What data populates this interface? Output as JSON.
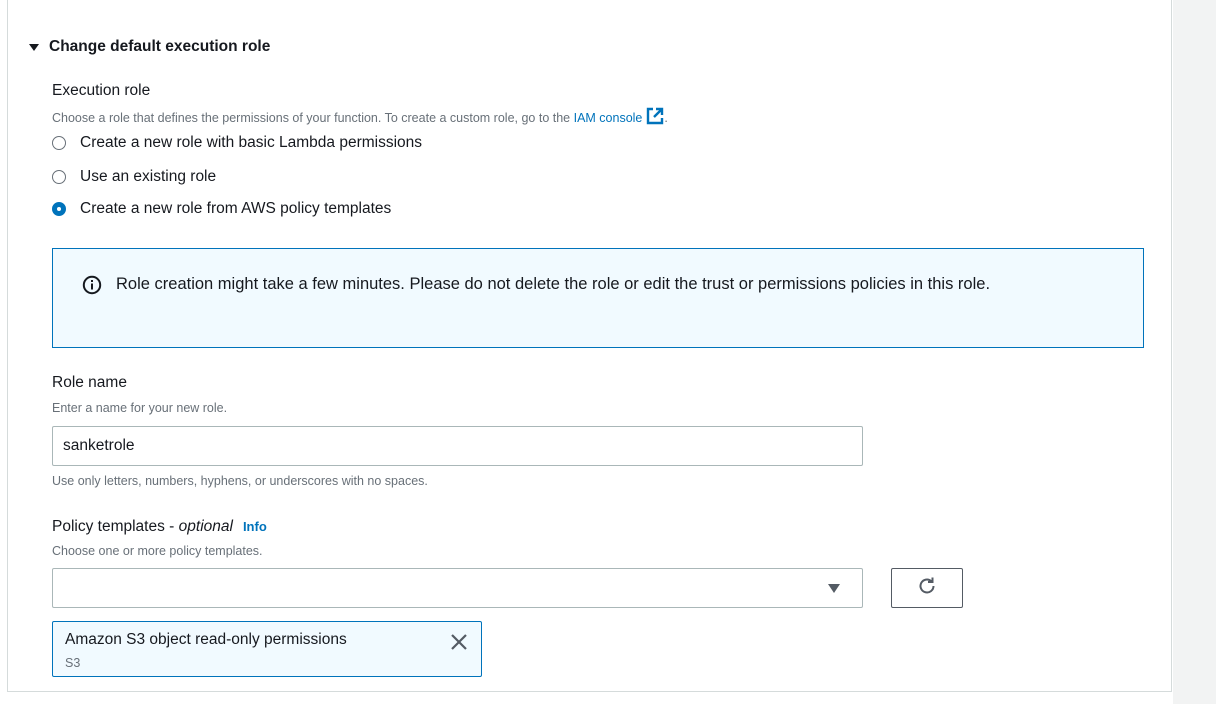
{
  "section": {
    "expander_label": "Change default execution role"
  },
  "execution_role": {
    "label": "Execution role",
    "description_prefix": "Choose a role that defines the permissions of your function. To create a custom role, go to the ",
    "link_text": "IAM console",
    "description_suffix": ".",
    "options": [
      {
        "label": "Create a new role with basic Lambda permissions",
        "selected": false
      },
      {
        "label": "Use an existing role",
        "selected": false
      },
      {
        "label": "Create a new role from AWS policy templates",
        "selected": true
      }
    ]
  },
  "alert": {
    "icon": "info-icon",
    "text": "Role creation might take a few minutes. Please do not delete the role or edit the trust or permissions policies in this role."
  },
  "role_name": {
    "label": "Role name",
    "description": "Enter a name for your new role.",
    "value": "sanketrole",
    "constraint": "Use only letters, numbers, hyphens, or underscores with no spaces."
  },
  "policy_templates": {
    "label": "Policy templates - ",
    "optional": "optional",
    "info_link": "Info",
    "description": "Choose one or more policy templates.",
    "selected_value": "",
    "tokens": [
      {
        "label": "Amazon S3 object read-only permissions",
        "sub": "S3"
      }
    ]
  },
  "colors": {
    "accent": "#0073bb",
    "alert_bg": "#f1faff",
    "text": "#16191f",
    "muted": "#687078"
  }
}
